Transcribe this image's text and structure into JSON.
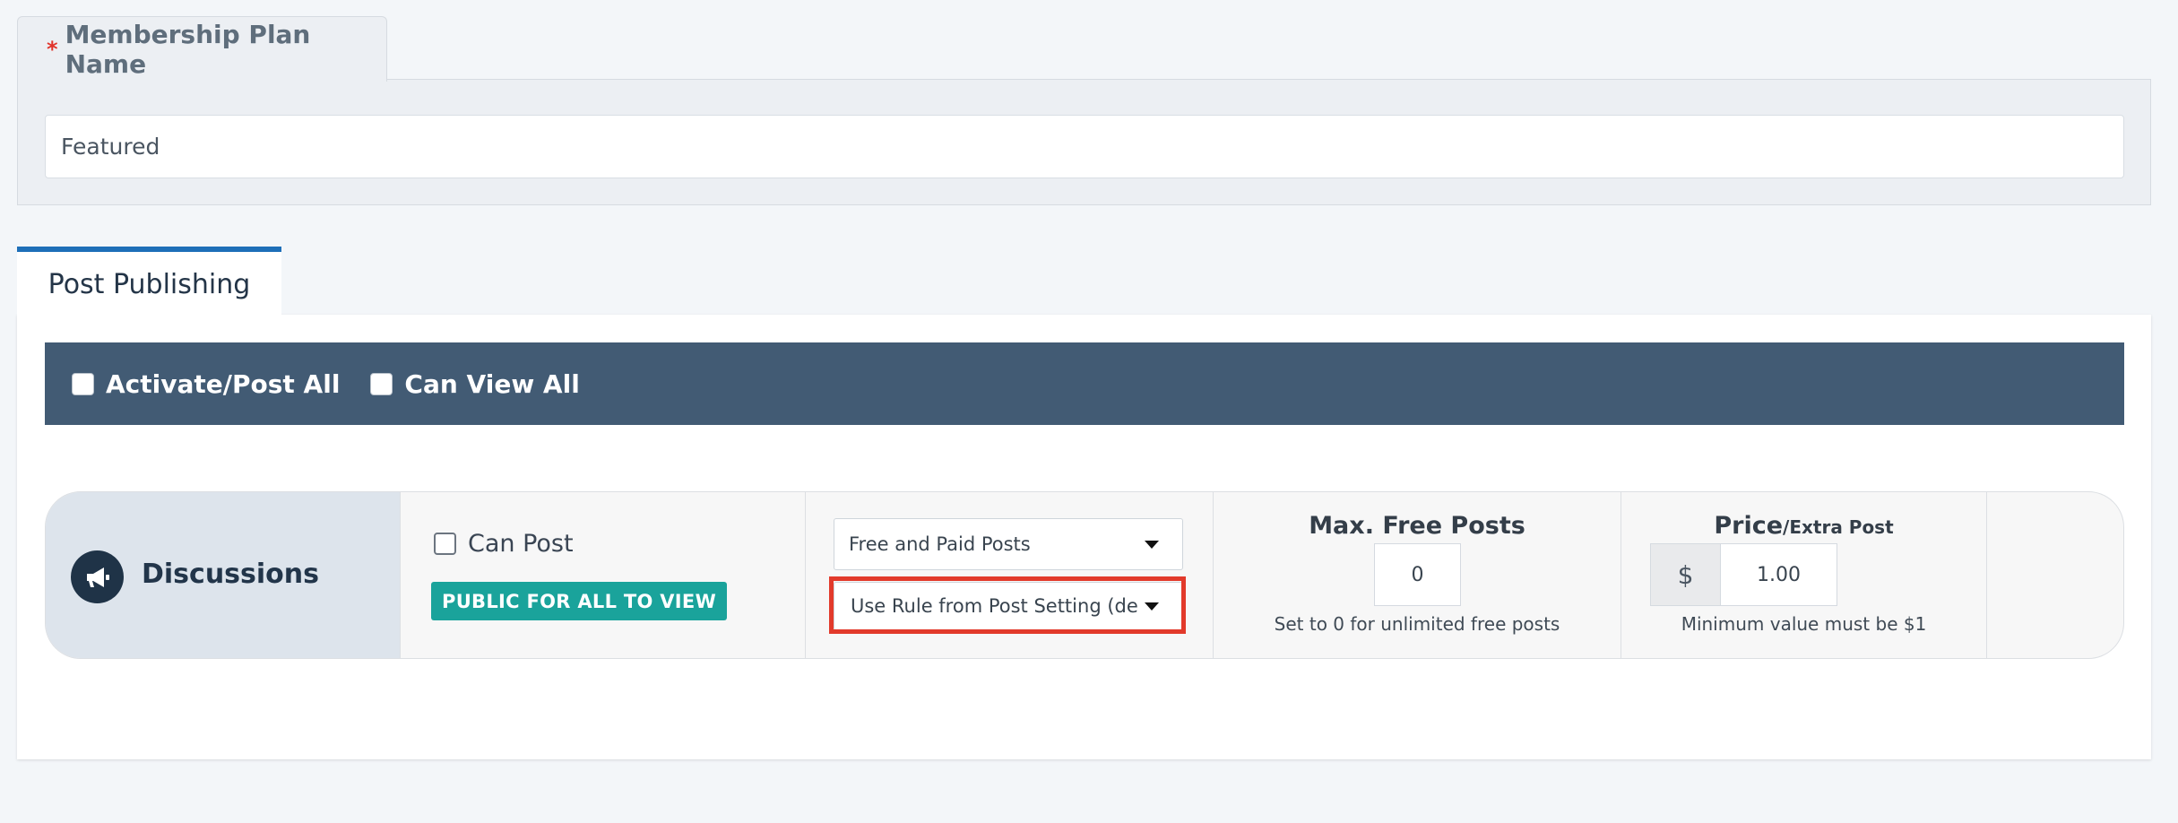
{
  "plan": {
    "required_mark": "*",
    "label": "Membership Plan Name",
    "value": "Featured"
  },
  "section_tab": "Post Publishing",
  "bar": {
    "activate_all": "Activate/Post All",
    "view_all": "Can View All"
  },
  "row": {
    "name": "Discussions",
    "icon": "megaphone-icon",
    "can_post": "Can Post",
    "badge": "PUBLIC FOR ALL TO VIEW",
    "post_type": "Free and Paid Posts",
    "rule": "Use Rule from Post Setting (default)",
    "max_free_title": "Max. Free Posts",
    "max_free_value": "0",
    "max_free_hint": "Set to 0 for unlimited free posts",
    "price_title": "Price",
    "price_suffix": "/Extra Post",
    "currency": "$",
    "price_value": "1.00",
    "price_hint": "Minimum value must be $1"
  },
  "colors": {
    "bar": "#425b74",
    "badge": "#1aa39b",
    "highlight": "#e23a2b",
    "tab_accent": "#1e6fb8"
  }
}
